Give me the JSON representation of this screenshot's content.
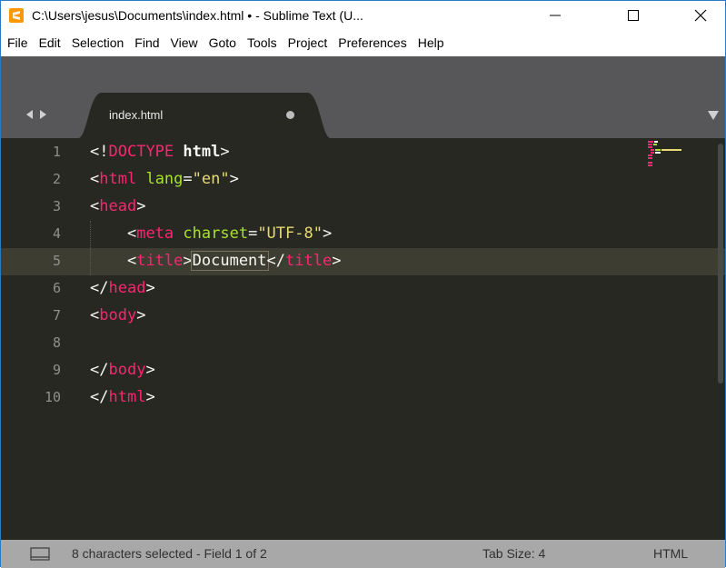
{
  "window": {
    "title": "C:\\Users\\jesus\\Documents\\index.html • - Sublime Text (U...",
    "controls": [
      "minimize",
      "maximize",
      "close"
    ]
  },
  "menu": {
    "items": [
      "File",
      "Edit",
      "Selection",
      "Find",
      "View",
      "Goto",
      "Tools",
      "Project",
      "Preferences",
      "Help"
    ]
  },
  "tabs": {
    "active": {
      "label": "index.html",
      "modified": true
    }
  },
  "editor": {
    "line_numbers": [
      "1",
      "2",
      "3",
      "4",
      "5",
      "6",
      "7",
      "8",
      "9",
      "10"
    ],
    "current_line": "5",
    "lines": [
      "<!DOCTYPE html>",
      "<html lang=\"en\">",
      "<head>",
      "    <meta charset=\"UTF-8\">",
      "    <title>Document</title>",
      "</head>",
      "<body>",
      "",
      "</body>",
      "</html>"
    ],
    "selection": "Document"
  },
  "status": {
    "selection_text": "8 characters selected - Field 1 of 2",
    "tab_size": "Tab Size: 4",
    "syntax": "HTML"
  },
  "colors": {
    "editor_bg": "#272822",
    "tag": "#f92672",
    "attribute": "#a6e22e",
    "string": "#e6db74",
    "status_bg": "#a8a8a8"
  }
}
